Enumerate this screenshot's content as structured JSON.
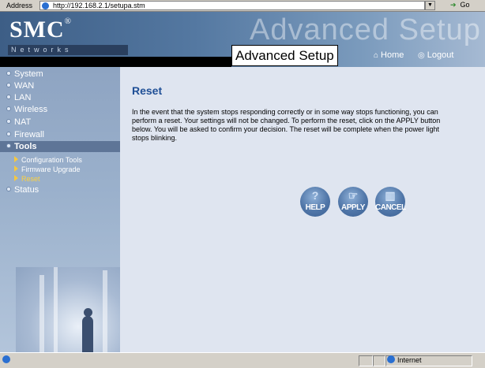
{
  "browser": {
    "address_label": "Address",
    "url": "http://192.168.2.1/setupa.stm",
    "go_label": "Go",
    "status_zone": "Internet"
  },
  "header": {
    "logo": "SMC",
    "logo_mark": "®",
    "networks": "Networks",
    "faded_title": "Advanced Setup",
    "title": "Advanced Setup",
    "home_label": "Home",
    "logout_label": "Logout"
  },
  "sidebar": {
    "items": [
      {
        "label": "System"
      },
      {
        "label": "WAN"
      },
      {
        "label": "LAN"
      },
      {
        "label": "Wireless"
      },
      {
        "label": "NAT"
      },
      {
        "label": "Firewall"
      },
      {
        "label": "Tools"
      },
      {
        "label": "Status"
      }
    ],
    "tools_sub": [
      {
        "label": "Configuration Tools"
      },
      {
        "label": "Firmware Upgrade"
      },
      {
        "label": "Reset"
      }
    ]
  },
  "main": {
    "title": "Reset",
    "description": "In the event that the system stops responding correctly or in some way stops functioning, you can perform a reset. Your settings will not be changed. To perform the reset, click on the APPLY button below. You will be asked to confirm your decision. The reset will be complete when the power light stops blinking.",
    "buttons": {
      "help": "HELP",
      "apply": "APPLY",
      "cancel": "CANCEL"
    }
  },
  "colors": {
    "accent": "#1f4f96",
    "active_sub": "#ffd23c",
    "sidebar_active": "#5e7597"
  }
}
